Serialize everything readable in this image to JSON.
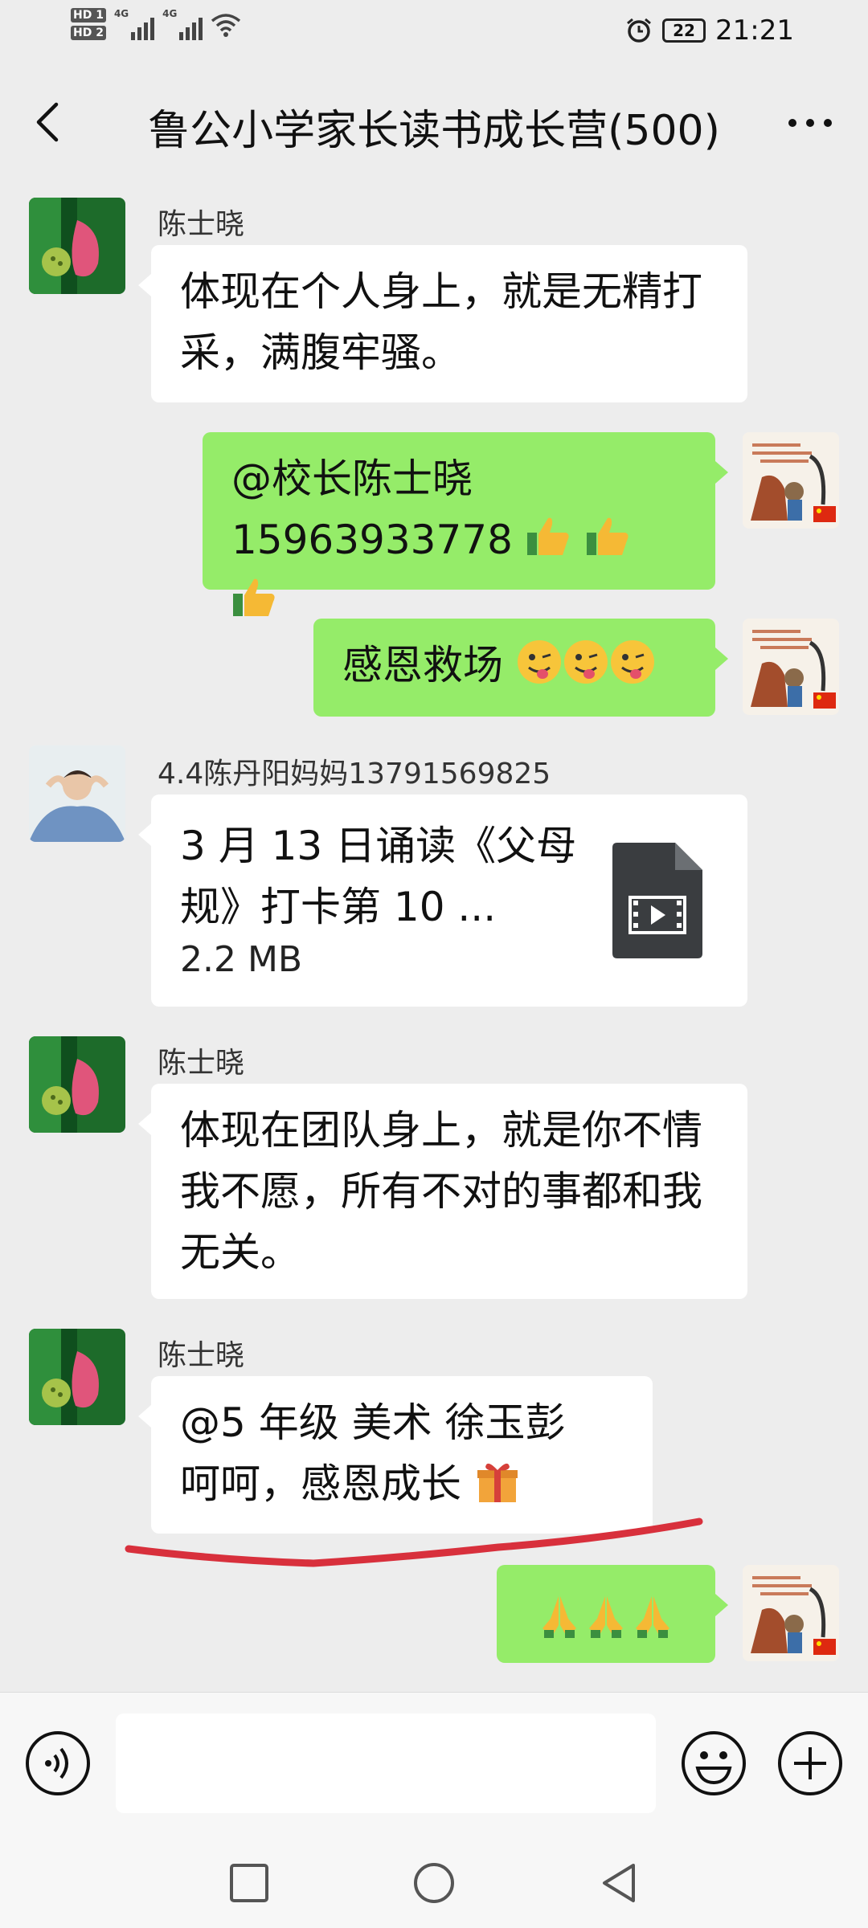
{
  "status_bar": {
    "sim1": "HD 1",
    "sim2": "HD 2",
    "network1": "4G",
    "network2": "4G",
    "battery": "22",
    "time": "21:21",
    "icons": [
      "signal-icon",
      "wifi-icon",
      "alarm-icon",
      "battery-icon"
    ]
  },
  "header": {
    "title": "鲁公小学家长读书成长营(500)",
    "icons": [
      "back-arrow-icon",
      "more-icon"
    ]
  },
  "messages": [
    {
      "type": "in",
      "sender": "陈士晓",
      "text": "体现在个人身上，就是无精打采，满腹牢骚。"
    },
    {
      "type": "out",
      "line1": "@校长陈士晓",
      "line2": "15963933778",
      "emoji": "thumbs-up-emoji ×3"
    },
    {
      "type": "out",
      "text": "感恩救场",
      "emoji": "winking-tongue-emoji ×3"
    },
    {
      "type": "in-file",
      "sender": "4.4陈丹阳妈妈13791569825",
      "file_name": "3 月 13 日诵读《父母规》打卡第 10 ...",
      "file_size": "2.2 MB",
      "icon": "video-file-icon"
    },
    {
      "type": "in",
      "sender": "陈士晓",
      "text": "体现在团队身上，就是你不情我不愿，所有不对的事都和我无关。"
    },
    {
      "type": "in",
      "sender": "陈士晓",
      "line1": "@5 年级 美术 徐玉彭",
      "line2": "呵呵，感恩成长",
      "emoji": "gift-emoji"
    },
    {
      "type": "out",
      "emoji": "folded-hands-emoji ×3"
    }
  ],
  "input_bar": {
    "placeholder": "",
    "icons": [
      "voice-icon",
      "emoji-icon",
      "plus-icon"
    ]
  },
  "nav_bar": {
    "icons": [
      "recent-apps-icon",
      "home-icon",
      "back-icon"
    ]
  },
  "colors": {
    "background": "#ededed",
    "bubble_out": "#95ec69",
    "bubble_in": "#ffffff",
    "annotation": "#d8303c"
  }
}
